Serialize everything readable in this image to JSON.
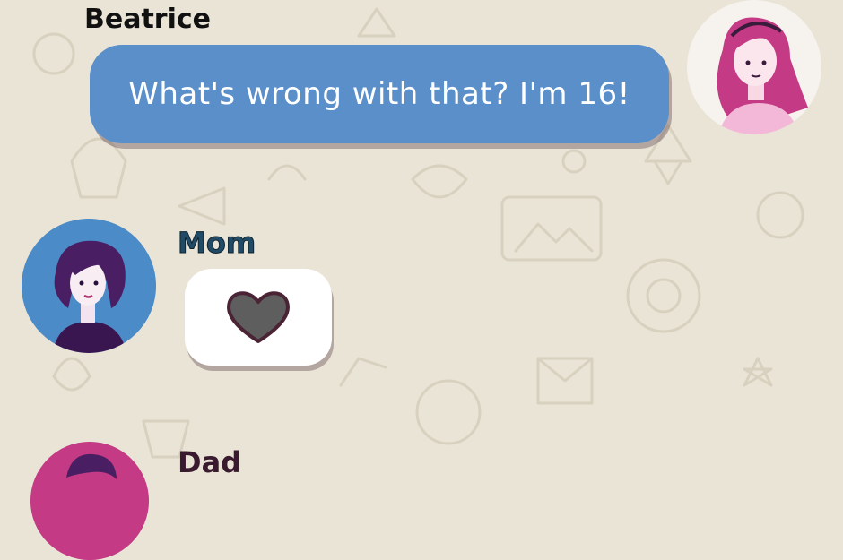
{
  "messages": [
    {
      "sender": "Beatrice",
      "text": "What's wrong with that? I'm 16!",
      "avatar_icon": "girl-pink-hair-avatar",
      "side": "right"
    },
    {
      "sender": "Mom",
      "content_icon": "heart-icon",
      "avatar_icon": "woman-dark-hair-avatar",
      "side": "left"
    },
    {
      "sender": "Dad",
      "avatar_icon": "man-avatar",
      "side": "left"
    }
  ],
  "colors": {
    "background": "#e9e4d6",
    "outgoing_bubble": "#5a8fca",
    "incoming_bubble": "#ffffff",
    "heart": "#5e5e5e",
    "mom_name": "#204a66"
  }
}
